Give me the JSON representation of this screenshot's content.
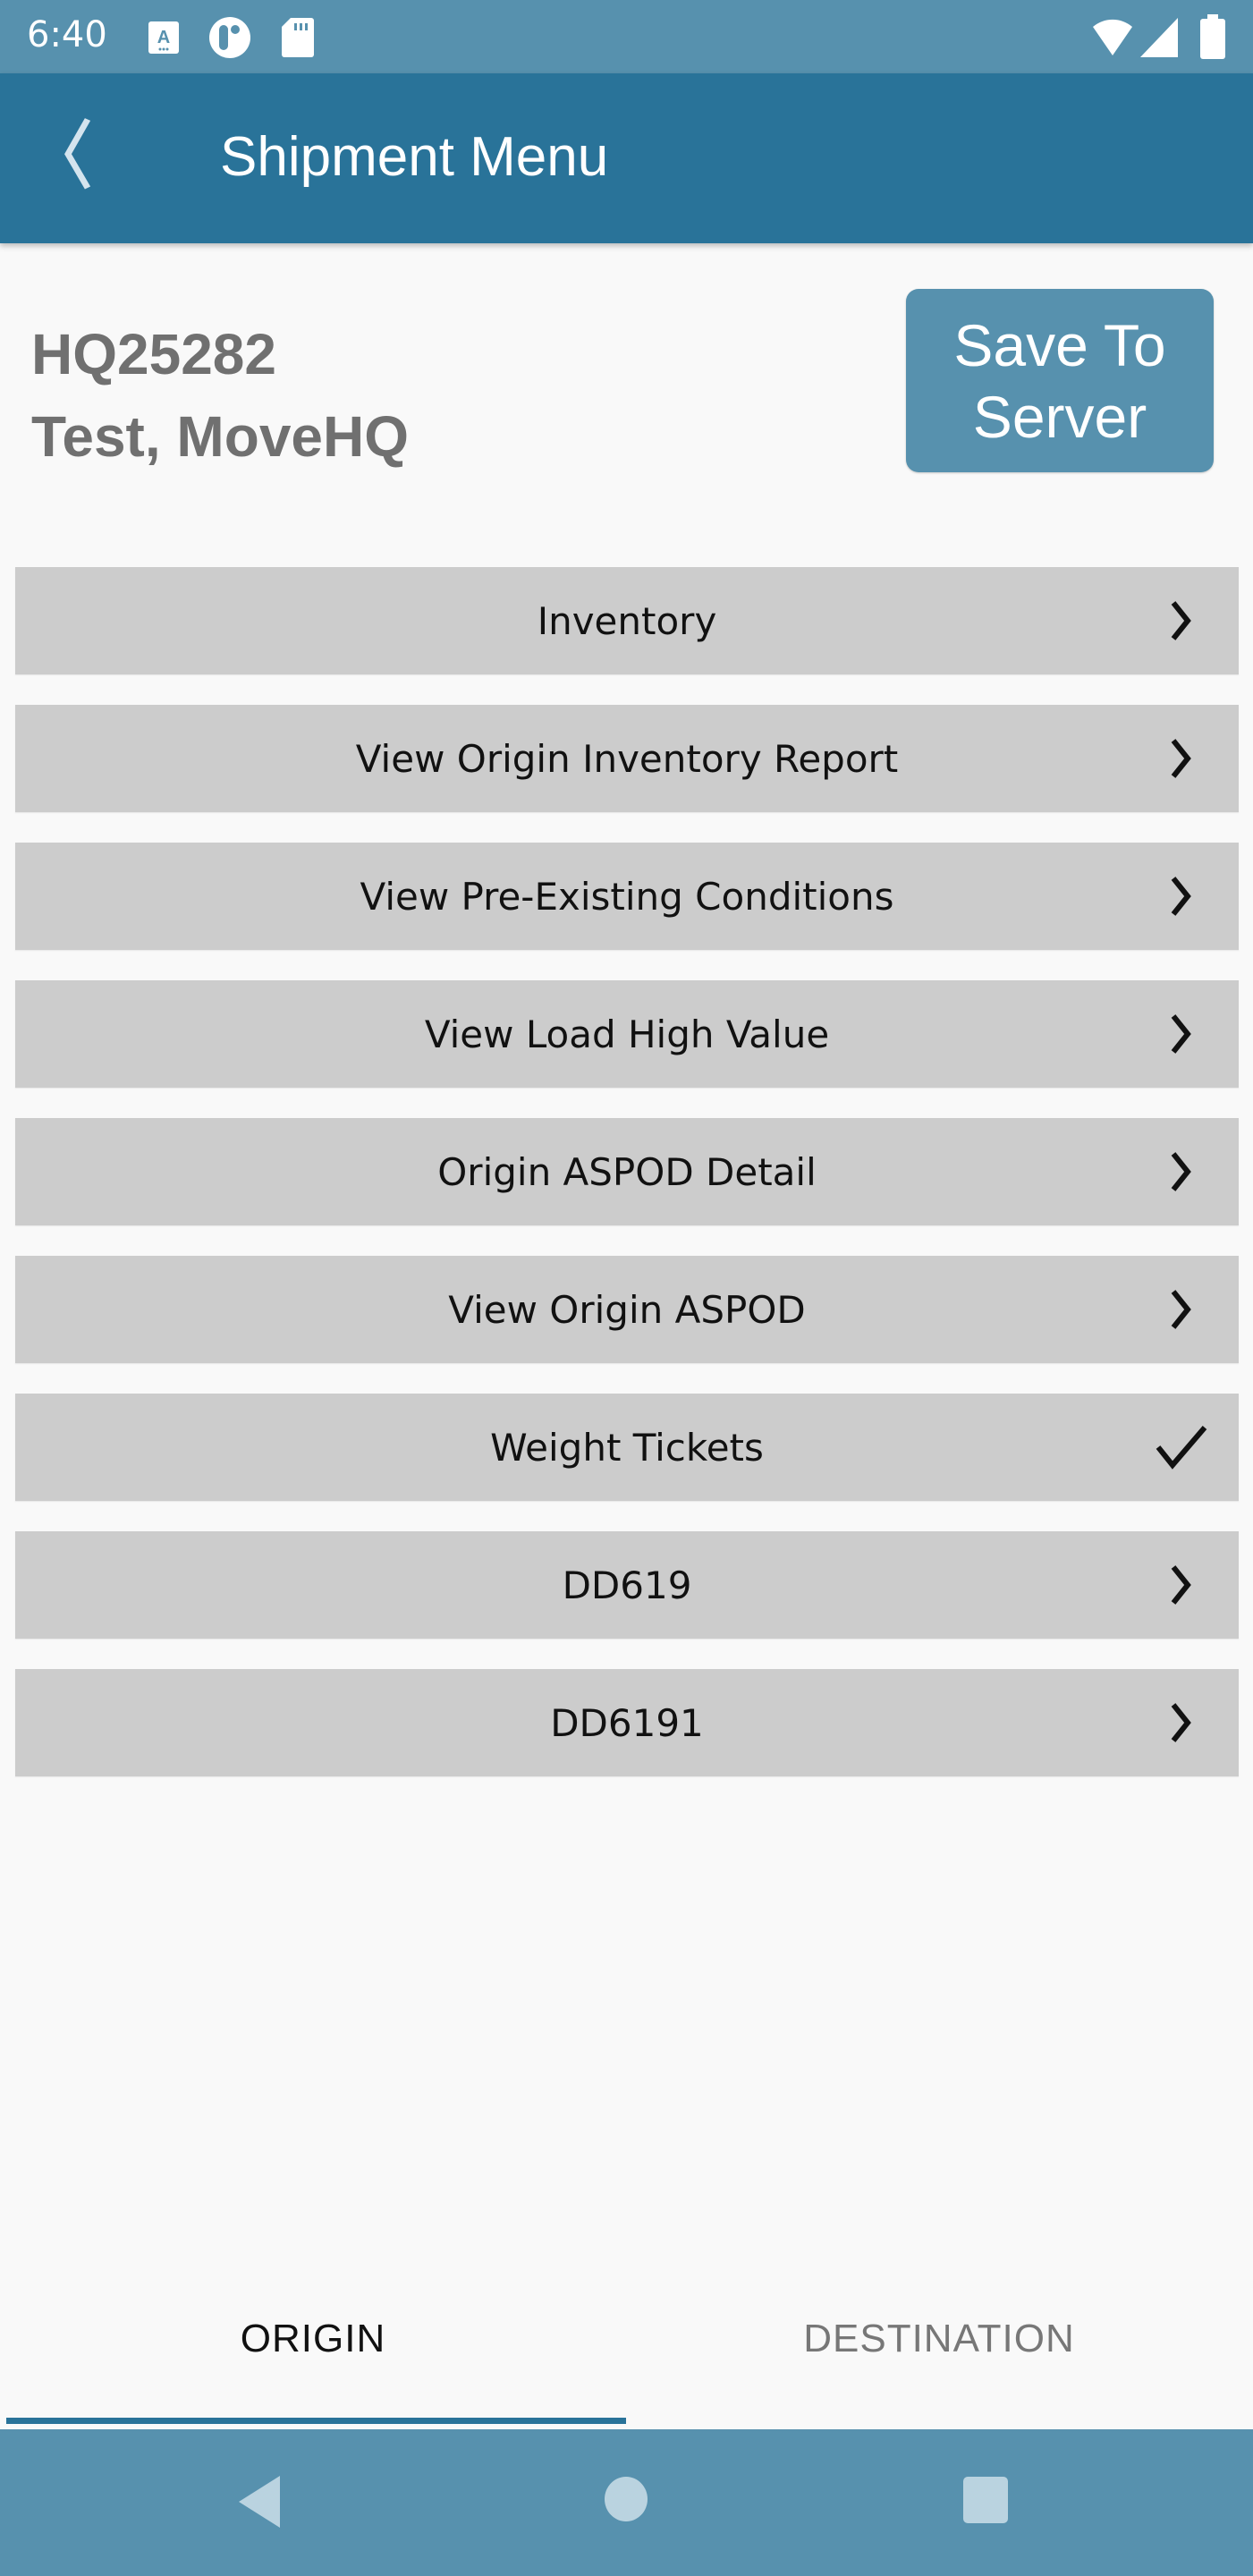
{
  "status_bar": {
    "time": "6:40",
    "left_icons": [
      "text-recognition-icon",
      "app-notification-icon",
      "sd-card-icon"
    ],
    "right_icons": [
      "wifi-icon",
      "cell-signal-icon",
      "battery-icon"
    ]
  },
  "app_bar": {
    "title": "Shipment Menu",
    "back_icon": "chevron-left-icon"
  },
  "shipment": {
    "id": "HQ25282",
    "customer": "Test, MoveHQ"
  },
  "save_button": {
    "line1": "Save To",
    "line2": "Server"
  },
  "menu": {
    "items": [
      {
        "label": "Inventory",
        "trail_icon": "chevron-right-icon"
      },
      {
        "label": "View Origin Inventory Report",
        "trail_icon": "chevron-right-icon"
      },
      {
        "label": "View Pre-Existing Conditions",
        "trail_icon": "chevron-right-icon"
      },
      {
        "label": "View Load High Value",
        "trail_icon": "chevron-right-icon"
      },
      {
        "label": "Origin ASPOD Detail",
        "trail_icon": "chevron-right-icon"
      },
      {
        "label": "View Origin ASPOD",
        "trail_icon": "chevron-right-icon"
      },
      {
        "label": "Weight Tickets",
        "trail_icon": "checkmark-icon"
      },
      {
        "label": "DD619",
        "trail_icon": "chevron-right-icon"
      },
      {
        "label": "DD6191",
        "trail_icon": "chevron-right-icon"
      }
    ]
  },
  "tabs": [
    {
      "label": "ORIGIN",
      "selected": true
    },
    {
      "label": "DESTINATION",
      "selected": false
    }
  ],
  "colors": {
    "status_bar": "#5791ae",
    "app_bar": "#297399",
    "accent": "#297399",
    "row_bg": "#cccccc"
  }
}
